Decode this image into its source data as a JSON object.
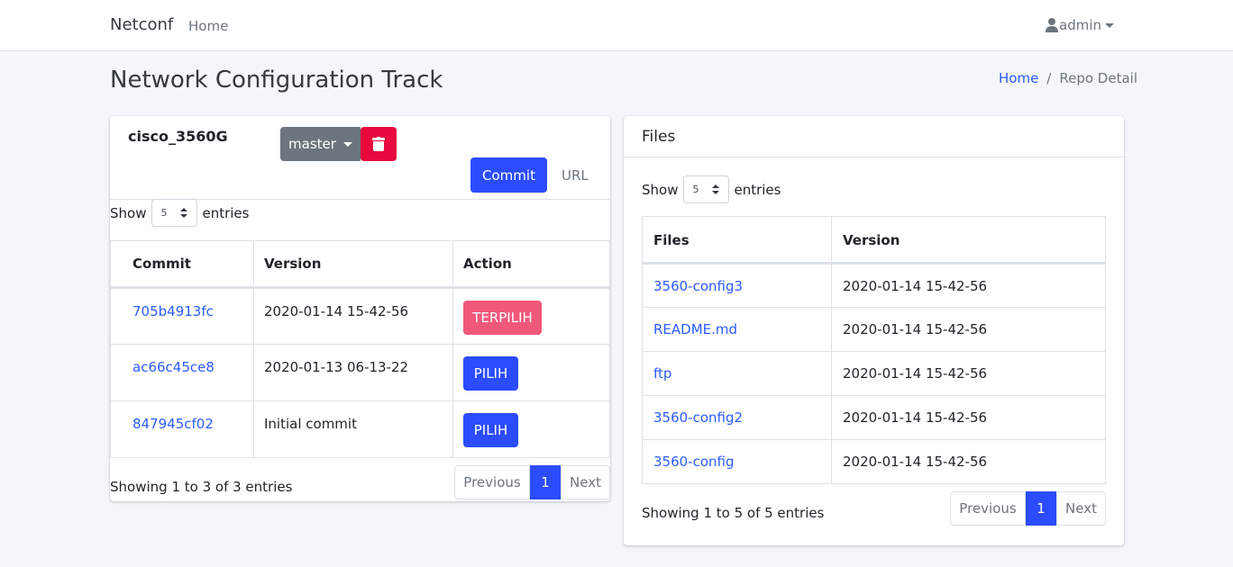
{
  "navbar": {
    "brand": "Netconf",
    "home_link": "Home",
    "user": "admin",
    "user_icon": "user-icon"
  },
  "page": {
    "title": "Network Configuration Track"
  },
  "breadcrumb": {
    "home": "Home",
    "separator": "/",
    "current": "Repo Detail"
  },
  "repo": {
    "name": "cisco_3560G",
    "branch": "master",
    "delete_icon": "trash-icon",
    "tabs": {
      "commit": "Commit",
      "url": "URL"
    }
  },
  "commits": {
    "show_label": "Show",
    "entries_value": "5",
    "entries_label": "entries",
    "columns": [
      "Commit",
      "Version",
      "Action"
    ],
    "rows": [
      {
        "commit": "705b4913fc",
        "version": "2020-01-14 15-42-56",
        "action": "TERPILIH"
      },
      {
        "commit": "ac66c45ce8",
        "version": "2020-01-13 06-13-22",
        "action": "PILIH"
      },
      {
        "commit": "847945cf02",
        "version": "Initial commit",
        "action": "PILIH"
      }
    ],
    "showing": "Showing 1 to 3 of 3 entries",
    "pagination": {
      "previous": "Previous",
      "page": "1",
      "next": "Next"
    }
  },
  "files": {
    "title": "Files",
    "show_label": "Show",
    "entries_value": "5",
    "entries_label": "entries",
    "columns": [
      "Files",
      "Version"
    ],
    "rows": [
      {
        "file": "3560-config3",
        "version": "2020-01-14 15-42-56"
      },
      {
        "file": "README.md",
        "version": "2020-01-14 15-42-56"
      },
      {
        "file": "ftp",
        "version": "2020-01-14 15-42-56"
      },
      {
        "file": "3560-config2",
        "version": "2020-01-14 15-42-56"
      },
      {
        "file": "3560-config",
        "version": "2020-01-14 15-42-56"
      }
    ],
    "showing": "Showing 1 to 5 of 5 entries",
    "pagination": {
      "previous": "Previous",
      "page": "1",
      "next": "Next"
    }
  },
  "colors": {
    "primary": "#2b4cff",
    "danger": "#e8083e",
    "selected": "#f0587a",
    "secondary": "#6c757d",
    "background": "#f4f6f9"
  }
}
